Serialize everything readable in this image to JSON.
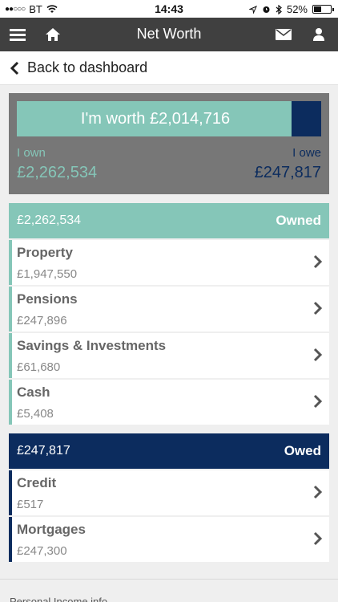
{
  "status": {
    "carrier": "BT",
    "time": "14:43",
    "battery": "52%",
    "battery_level": 0.52
  },
  "nav": {
    "title": "Net Worth"
  },
  "back": {
    "label": "Back to dashboard"
  },
  "summary": {
    "headline": "I'm worth £2,014,716",
    "own_label": "I own",
    "own_value": "£2,262,534",
    "owe_label": "I owe",
    "owe_value": "£247,817",
    "owe_fraction": 0.0987
  },
  "owned": {
    "total": "£2,262,534",
    "label": "Owned",
    "items": [
      {
        "name": "Property",
        "value": "£1,947,550"
      },
      {
        "name": "Pensions",
        "value": "£247,896"
      },
      {
        "name": "Savings & Investments",
        "value": "£61,680"
      },
      {
        "name": "Cash",
        "value": "£5,408"
      }
    ]
  },
  "owed": {
    "total": "£247,817",
    "label": "Owed",
    "items": [
      {
        "name": "Credit",
        "value": "£517"
      },
      {
        "name": "Mortgages",
        "value": "£247,300"
      }
    ]
  },
  "footer": {
    "text": "Personal Income info..."
  },
  "colors": {
    "owned": "#85c6b8",
    "owed": "#0c2c5e",
    "navbar": "#404040"
  }
}
